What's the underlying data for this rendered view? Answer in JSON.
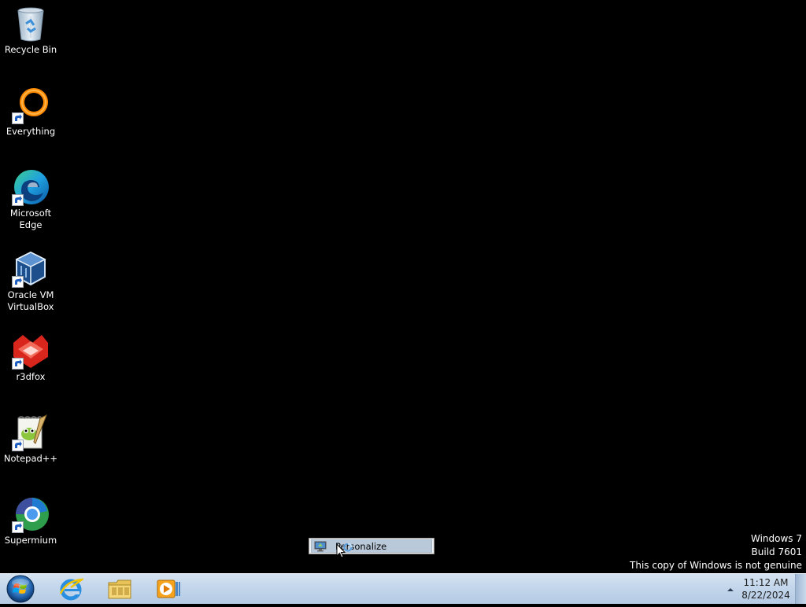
{
  "desktop": {
    "icons": [
      {
        "name": "recycle-bin",
        "label_lines": [
          "Recycle Bin"
        ],
        "icon": "recycle-bin-icon",
        "shortcut": false
      },
      {
        "name": "everything",
        "label_lines": [
          "Everything"
        ],
        "icon": "everything-icon",
        "shortcut": true
      },
      {
        "name": "microsoft-edge",
        "label_lines": [
          "Microsoft",
          "Edge"
        ],
        "icon": "edge-icon",
        "shortcut": true
      },
      {
        "name": "oracle-vm-virtualbox",
        "label_lines": [
          "Oracle VM",
          "VirtualBox"
        ],
        "icon": "virtualbox-icon",
        "shortcut": true
      },
      {
        "name": "r3dfox",
        "label_lines": [
          "r3dfox"
        ],
        "icon": "r3dfox-icon",
        "shortcut": true
      },
      {
        "name": "notepad-plus-plus",
        "label_lines": [
          "Notepad++"
        ],
        "icon": "notepad-plus-plus-icon",
        "shortcut": true
      },
      {
        "name": "supermium",
        "label_lines": [
          "Supermium"
        ],
        "icon": "supermium-icon",
        "shortcut": true
      }
    ]
  },
  "watermark": {
    "line1": "Windows 7",
    "line2": "Build 7601",
    "line3": "This copy of Windows is not genuine"
  },
  "context_menu": {
    "items": [
      {
        "label": "Personalize",
        "icon": "personalize-icon",
        "highlighted": true
      }
    ]
  },
  "taskbar": {
    "start_icon": "windows-start-orb-icon",
    "pinned": [
      {
        "name": "internet-explorer",
        "icon": "internet-explorer-icon"
      },
      {
        "name": "windows-explorer",
        "icon": "folder-icon"
      },
      {
        "name": "media-player",
        "icon": "media-player-icon"
      }
    ],
    "tray": {
      "show_hidden_icon": "chevron-up-icon",
      "time": "11:12 AM",
      "date": "8/22/2024"
    }
  },
  "colors": {
    "desktop_background": "#000000",
    "taskbar_top": "#d6e3f1",
    "taskbar_bottom": "#b5cbe4",
    "menu_highlight": "#b9c9da"
  }
}
